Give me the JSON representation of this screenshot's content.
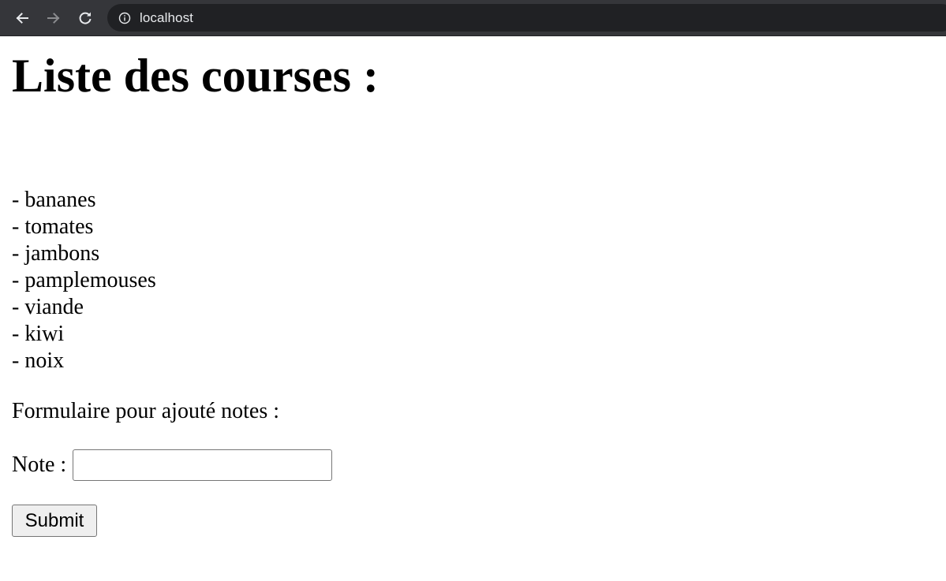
{
  "browser": {
    "url": "localhost",
    "icons": {
      "back": "arrow-left-icon",
      "forward": "arrow-right-icon",
      "reload": "reload-icon",
      "site_info": "info-icon"
    },
    "colors": {
      "toolbar": "#35363a",
      "address_bar": "#202124",
      "url_text": "#e8eaed"
    }
  },
  "page": {
    "title": "Liste des courses :",
    "items": [
      "- bananes",
      "- tomates",
      "- jambons",
      "- pamplemouses",
      "- viande",
      "- kiwi",
      "- noix"
    ],
    "form": {
      "heading": "Formulaire pour ajouté notes :",
      "note_label": "Note :",
      "note_value": "",
      "submit_label": "Submit"
    }
  }
}
